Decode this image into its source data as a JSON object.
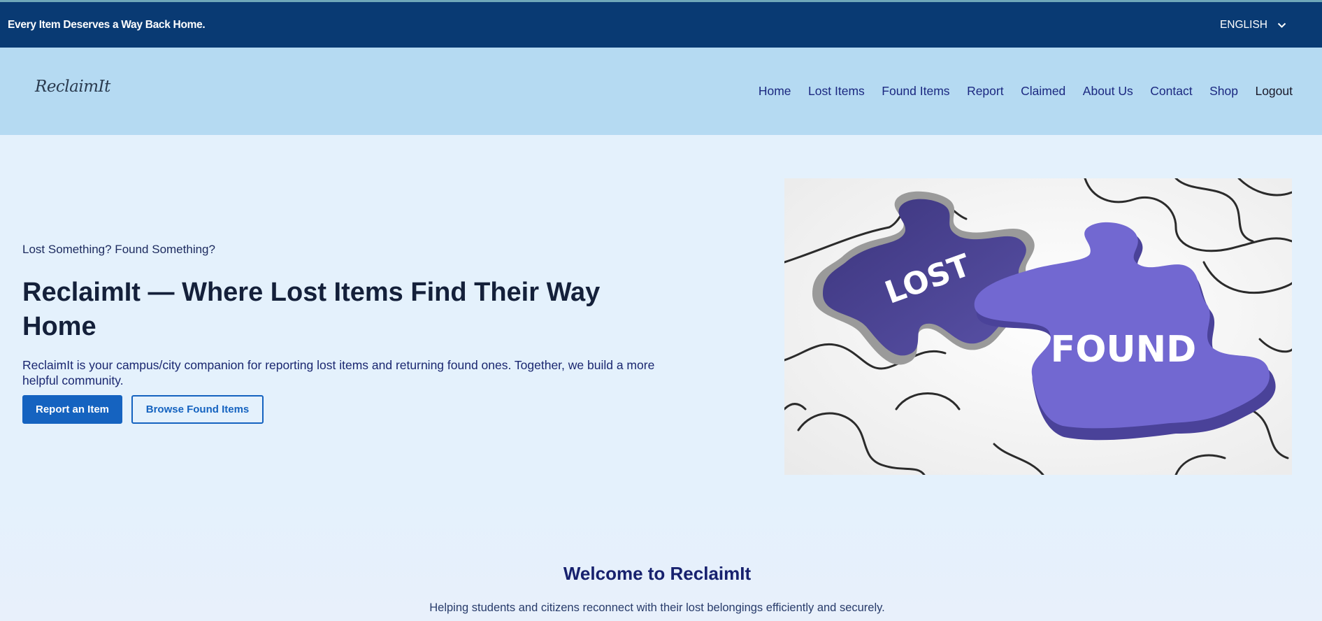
{
  "topbar": {
    "tagline": "Every Item Deserves a Way Back Home.",
    "language": "ENGLISH"
  },
  "brand": {
    "logo_text": "ReclaimIt"
  },
  "nav": {
    "items": [
      "Home",
      "Lost Items",
      "Found Items",
      "Report",
      "Claimed",
      "About Us",
      "Contact",
      "Shop",
      "Logout"
    ]
  },
  "hero": {
    "kicker": "Lost Something? Found Something?",
    "title": "ReclaimIt — Where Lost Items Find Their Way Home",
    "description": "ReclaimIt is your campus/city companion for reporting lost items and returning found ones. Together, we build a more helpful community.",
    "primary_button": "Report an Item",
    "secondary_button": "Browse Found Items",
    "image": {
      "piece_lost_text": "LOST",
      "piece_found_text": "FOUND"
    }
  },
  "welcome": {
    "title": "Welcome to ReclaimIt",
    "subtitle": "Helping students and citizens reconnect with their lost belongings efficiently and securely."
  },
  "colors": {
    "topbar": "#093a73",
    "navbar": "#b5daf2",
    "page_bg": "#e4f1fc",
    "primary": "#1563c0",
    "puzzle_purple": "#7268d1"
  }
}
